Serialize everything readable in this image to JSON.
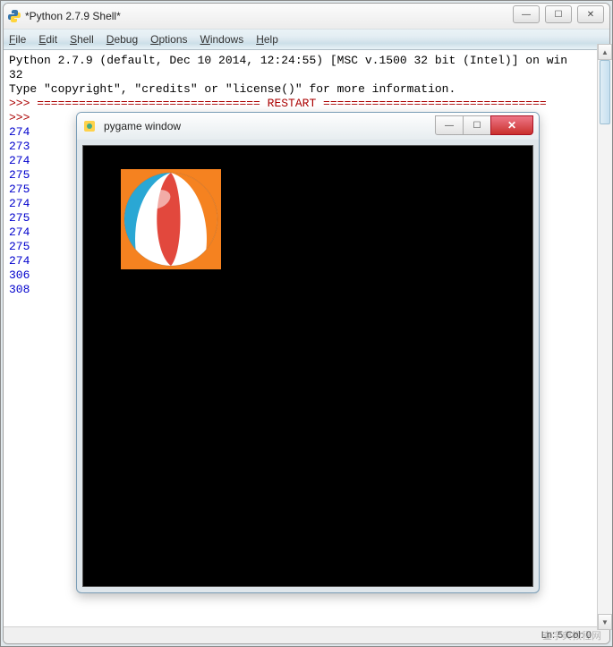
{
  "idle_window": {
    "title": "*Python 2.7.9 Shell*",
    "menu": [
      "File",
      "Edit",
      "Shell",
      "Debug",
      "Options",
      "Windows",
      "Help"
    ],
    "header_line1": "Python 2.7.9 (default, Dec 10 2014, 12:24:55) [MSC v.1500 32 bit (Intel)] on win",
    "header_line2": "32",
    "header_line3": "Type \"copyright\", \"credits\" or \"license()\" for more information.",
    "restart_line": ">>> ================================ RESTART ================================",
    "prompt": ">>> ",
    "outputs": [
      "274",
      "273",
      "274",
      "275",
      "275",
      "274",
      "275",
      "274",
      "275",
      "274",
      "306",
      "308"
    ],
    "status": "Ln: 5 Col: 0"
  },
  "win_symbols": {
    "min": "—",
    "max": "☐",
    "close": "✕",
    "up": "▲",
    "down": "▼"
  },
  "pygame_window": {
    "title": "pygame window"
  },
  "watermark": "查字典教程网"
}
